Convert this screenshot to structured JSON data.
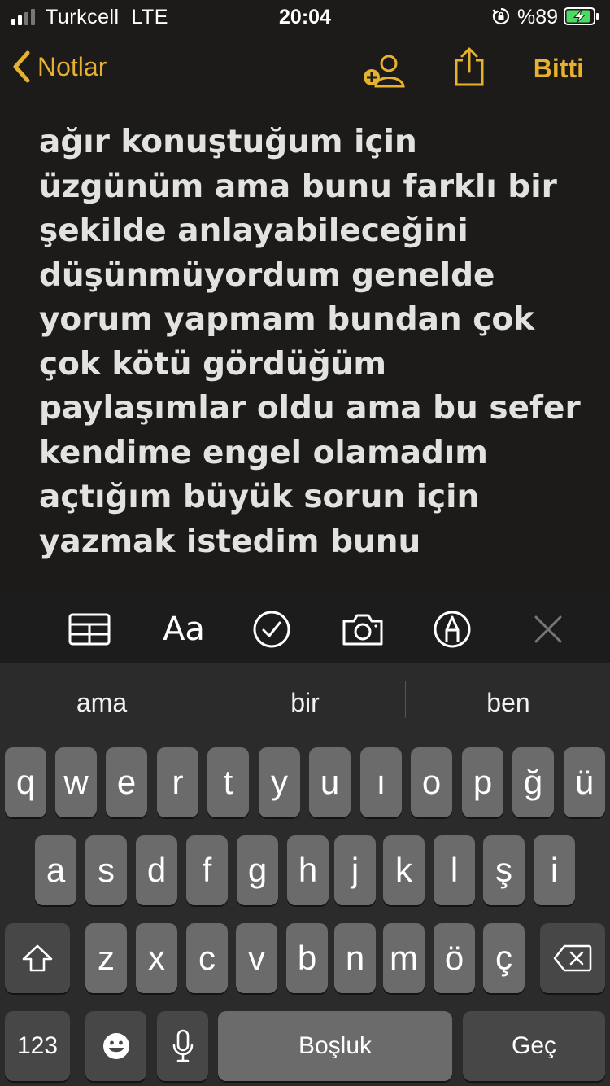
{
  "status_bar": {
    "carrier": "Turkcell  LTE",
    "time": "20:04",
    "battery_percent": "%89",
    "battery_level": 0.89,
    "signal_bars": 2
  },
  "nav": {
    "back_label": "Notlar",
    "done_label": "Bitti",
    "accent": "#e5b12e"
  },
  "note": {
    "lines": [
      "ağır konuştuğum için",
      "üzgünüm ama bunu farklı bir",
      "şekilde anlayabileceğini",
      "düşünmüyordum genelde",
      "yorum yapmam bundan çok",
      "çok kötü gördüğüm",
      "paylaşımlar oldu ama bu sefer",
      "kendime engel olamadım",
      "açtığım büyük sorun için",
      "yazmak istedim bunu"
    ]
  },
  "toolbar": {
    "format_label": "Aa",
    "icons": [
      "table-icon",
      "text-format-icon",
      "checklist-icon",
      "camera-icon",
      "markup-pen-icon",
      "close-icon"
    ]
  },
  "keyboard": {
    "suggestions": [
      "ama",
      "bir",
      "ben"
    ],
    "row1": [
      "q",
      "w",
      "e",
      "r",
      "t",
      "y",
      "u",
      "ı",
      "o",
      "p",
      "ğ",
      "ü"
    ],
    "row2": [
      "a",
      "s",
      "d",
      "f",
      "g",
      "h",
      "j",
      "k",
      "l",
      "ş",
      "i"
    ],
    "row3": [
      "z",
      "x",
      "c",
      "v",
      "b",
      "n",
      "m",
      "ö",
      "ç"
    ],
    "numbers_label": "123",
    "space_label": "Boşluk",
    "return_label": "Geç"
  }
}
